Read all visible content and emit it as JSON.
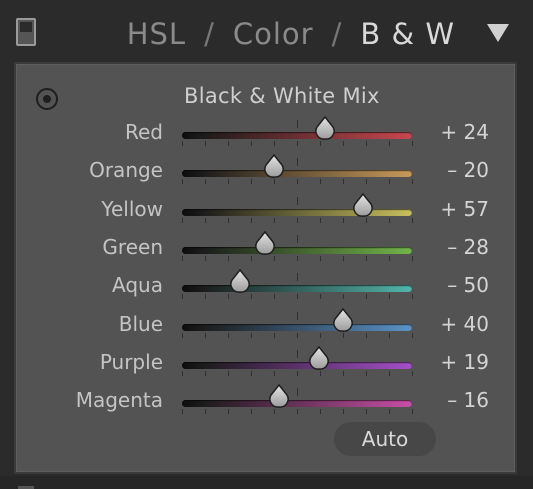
{
  "header": {
    "tabs": [
      {
        "label": "HSL",
        "active": false
      },
      {
        "label": "Color",
        "active": false
      },
      {
        "label": "B & W",
        "active": true
      }
    ],
    "separator": "/",
    "collapse_icon": "triangle-down-icon",
    "toggle_icon": "panel-switch-icon"
  },
  "panel": {
    "title": "Black & White Mix",
    "target_icon": "targeted-adjustment-icon",
    "sliders": [
      {
        "label": "Red",
        "value": 24,
        "display": "+ 24",
        "color": "#c8474f"
      },
      {
        "label": "Orange",
        "value": -20,
        "display": "– 20",
        "color": "#c89a5a"
      },
      {
        "label": "Yellow",
        "value": 57,
        "display": "+ 57",
        "color": "#c8bf5e"
      },
      {
        "label": "Green",
        "value": -28,
        "display": "– 28",
        "color": "#72b54a"
      },
      {
        "label": "Aqua",
        "value": -50,
        "display": "– 50",
        "color": "#52b5ab"
      },
      {
        "label": "Blue",
        "value": 40,
        "display": "+ 40",
        "color": "#5a93c8"
      },
      {
        "label": "Purple",
        "value": 19,
        "display": "+ 19",
        "color": "#a54fc8"
      },
      {
        "label": "Magenta",
        "value": -16,
        "display": "– 16",
        "color": "#c84fa6"
      }
    ],
    "range": [
      -100,
      100
    ],
    "auto_label": "Auto"
  }
}
